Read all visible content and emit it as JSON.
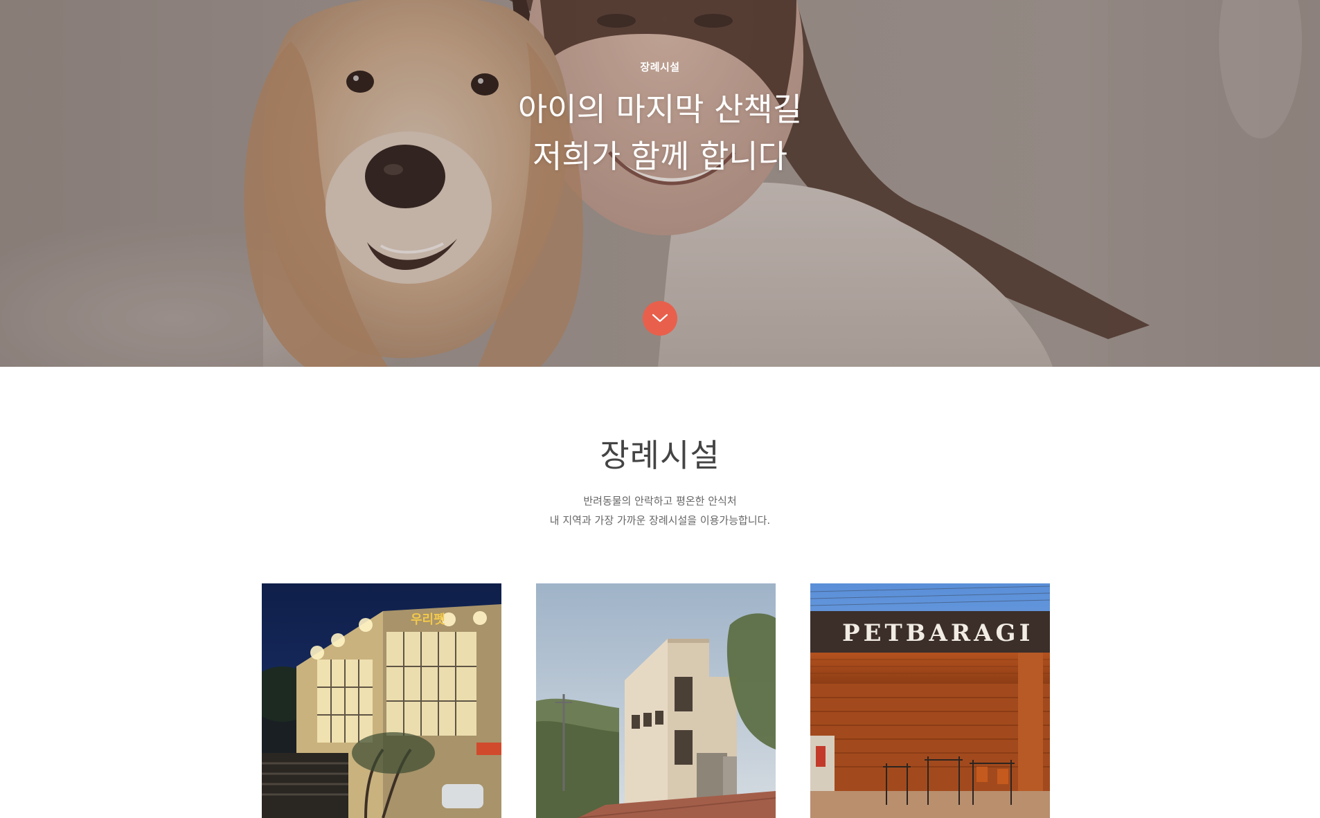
{
  "hero": {
    "eyebrow": "장례시설",
    "title_line1": "아이의 마지막 산책길",
    "title_line2": "저희가 함께 합니다",
    "scroll_icon": "chevron-down-icon",
    "accent_color": "#e8604c"
  },
  "section": {
    "title": "장례시설",
    "desc_line1": "반려동물의 안락하고 평온한 안식처",
    "desc_line2": "내 지역과 가장 가까운 장례시설을 이용가능합니다."
  },
  "facilities": [
    {
      "sign_text": "우리펫"
    },
    {
      "sign_text": ""
    },
    {
      "sign_text": "PETBARAGI"
    }
  ]
}
